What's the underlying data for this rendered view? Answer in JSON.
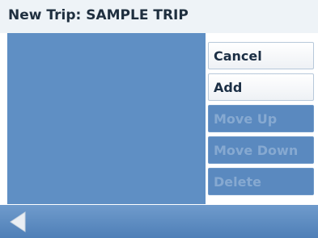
{
  "header": {
    "title": "New Trip: SAMPLE TRIP"
  },
  "actions": {
    "cancel": "Cancel",
    "add": "Add",
    "move_up": "Move Up",
    "move_down": "Move Down",
    "delete": "Delete"
  },
  "footer": {
    "back_icon": "back-arrow-icon"
  },
  "colors": {
    "panel": "#5f8fc4",
    "header_bg": "#eef3f7",
    "disabled_text": "#86a9d1",
    "enabled_text": "#1c2f45"
  }
}
